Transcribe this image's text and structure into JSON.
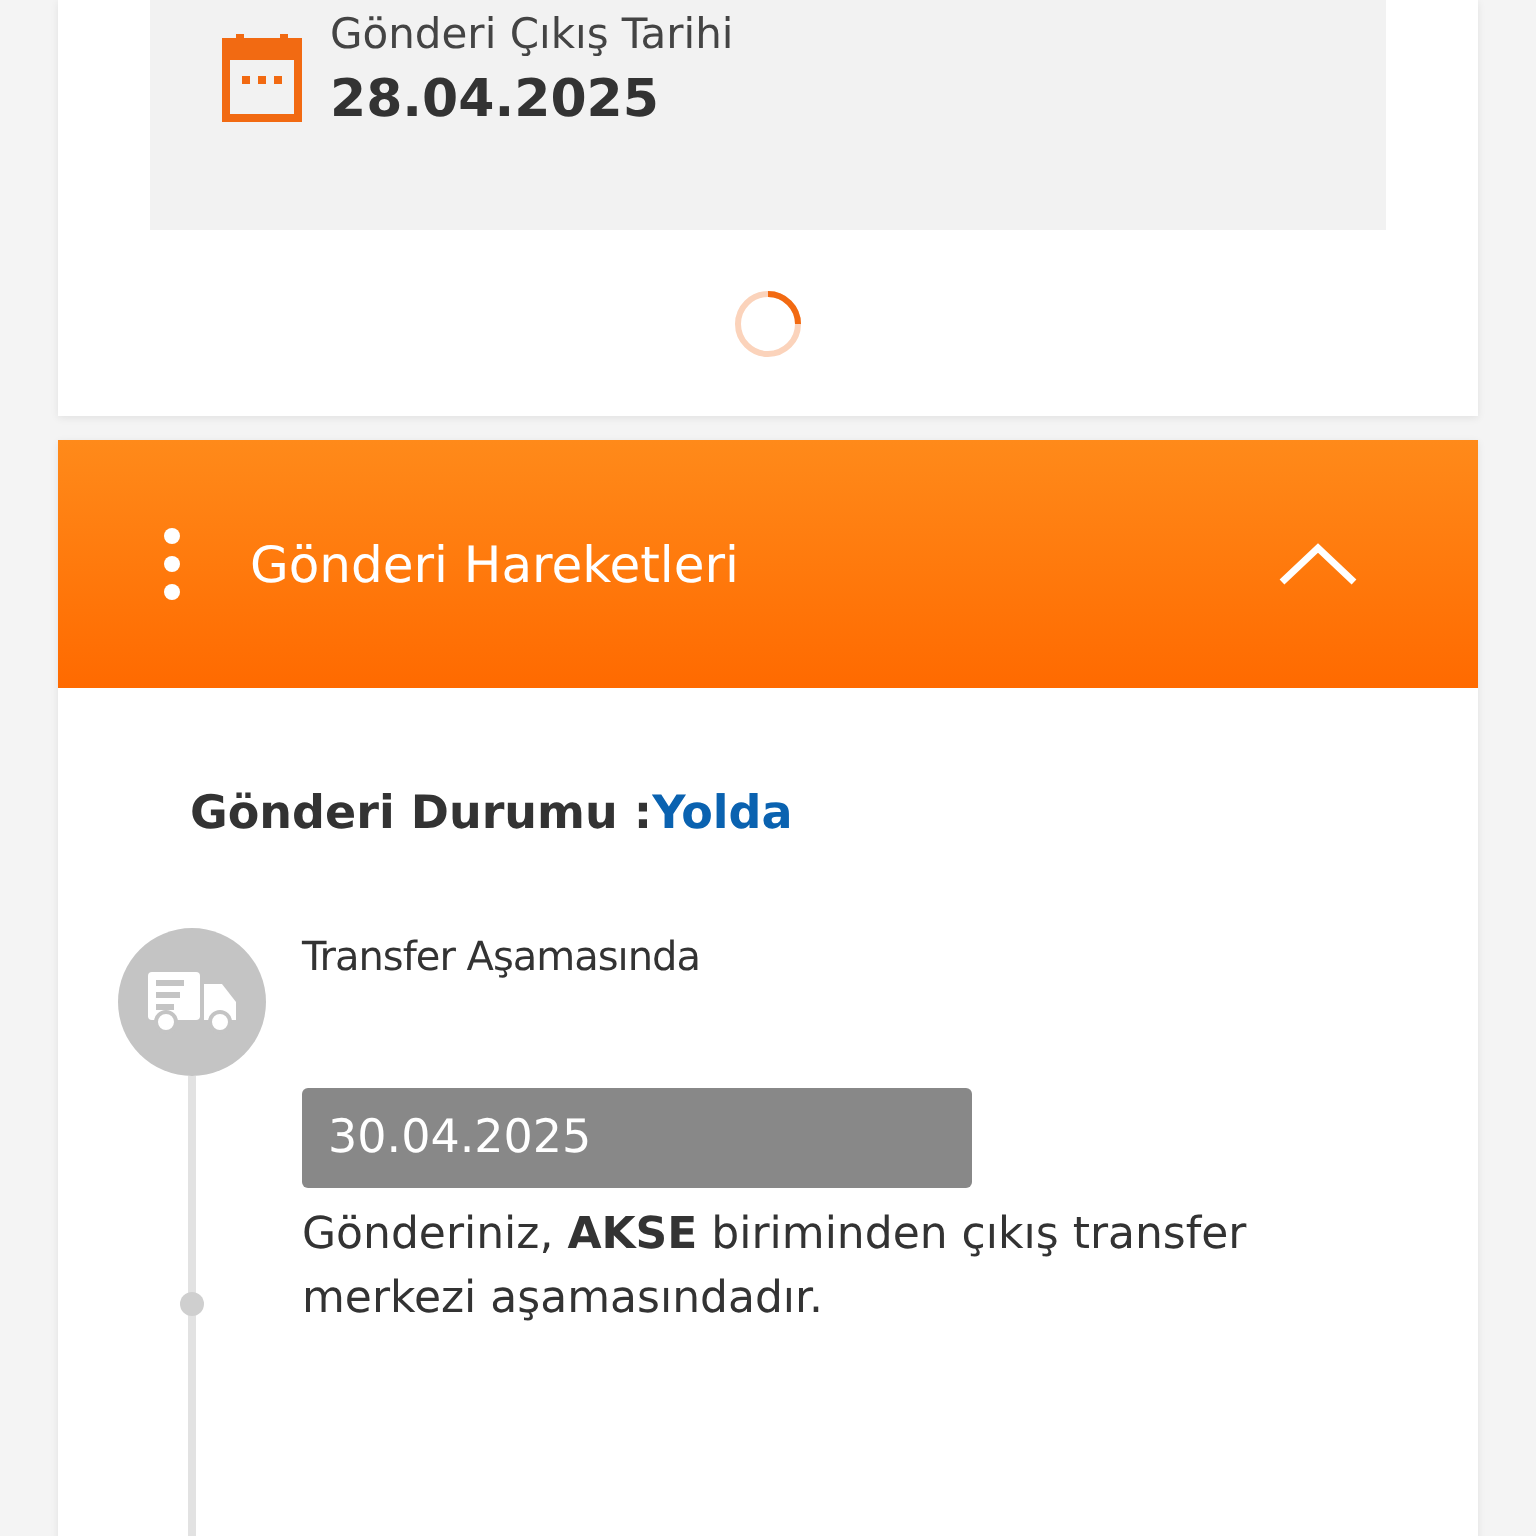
{
  "departure": {
    "label": "Gönderi Çıkış Tarihi",
    "date": "28.04.2025"
  },
  "movements": {
    "title": "Gönderi Hareketleri",
    "expanded": true,
    "status_label": "Gönderi Durumu :",
    "status_value": "Yolda",
    "events": [
      {
        "title": "Transfer Aşamasında",
        "date": "30.04.2025",
        "description": "Gönderiniz, **AKSE** biriminden çıkış transfer merkezi aşamasındadır."
      }
    ]
  }
}
